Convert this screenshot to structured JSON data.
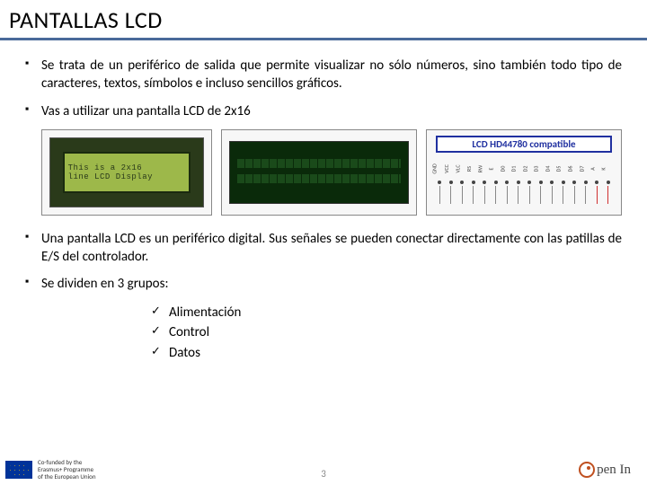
{
  "title": "PANTALLAS LCD",
  "bullets": {
    "b1": "Se trata de un  periférico  de salida que permite visualizar no sólo números, sino también todo tipo de caracteres, textos, símbolos e incluso sencillos gráficos.",
    "b2": "Vas a utilizar una pantalla LCD de 2x16",
    "b3": "Una pantalla LCD es  un periférico digital. Sus señales se  pueden conectar directamente con las patillas de E/S del controlador.",
    "b4": "Se dividen en 3 grupos:"
  },
  "lcd_demo": {
    "line1": "This is a 2x16",
    "line2": "line LCD Display"
  },
  "pinout": {
    "title": "LCD HD44780 compatible",
    "pins": [
      "GND",
      "VCC",
      "VLC",
      "RS",
      "RW",
      "E",
      "D0",
      "D1",
      "D2",
      "D3",
      "D4",
      "D5",
      "D6",
      "D7",
      "A",
      "K"
    ]
  },
  "groups": {
    "g1": "Alimentación",
    "g2": "Control",
    "g3": "Datos"
  },
  "footer": {
    "cofund_line1": "Co-funded by the",
    "cofund_line2": "Erasmus+ Programme",
    "cofund_line3": "of the European Union",
    "page": "3",
    "logo_text": "pen In"
  }
}
